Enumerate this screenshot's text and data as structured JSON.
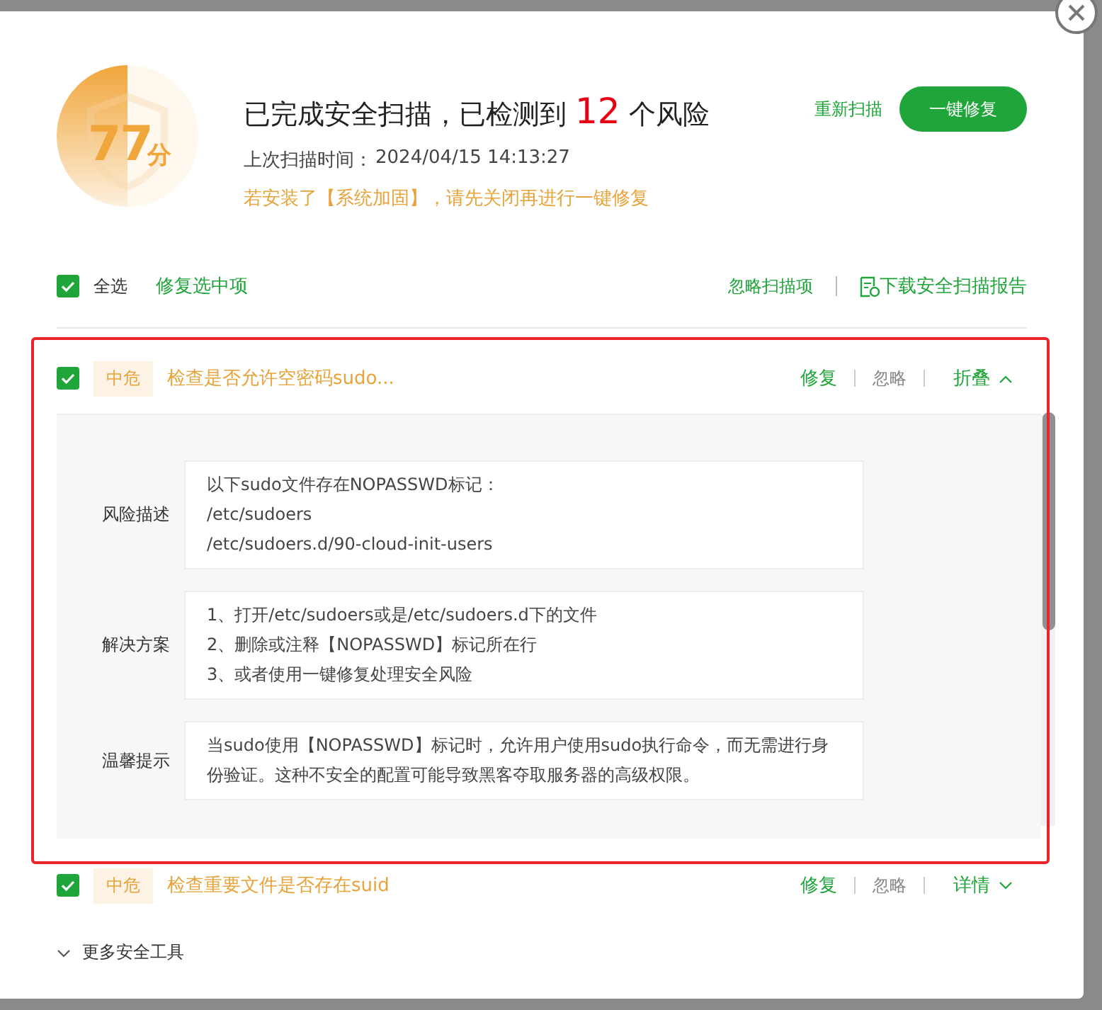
{
  "score": {
    "value": "77",
    "unit": "分"
  },
  "summary": {
    "prefix": "已完成安全扫描，已检测到",
    "count": "12",
    "suffix": "个风险"
  },
  "last_scan": {
    "label": "上次扫描时间：",
    "time": "2024/04/15 14:13:27"
  },
  "notice": "若安装了【系统加固】，请先关闭再进行一键修复",
  "actions": {
    "rescan": "重新扫描",
    "fix_all": "一键修复"
  },
  "toolbar": {
    "select_all": {
      "label": "全选",
      "checked": true
    },
    "fix_selected": "修复选中项",
    "ignore_items": "忽略扫描项",
    "download_report": "下载安全扫描报告"
  },
  "risks": [
    {
      "checked": true,
      "level": "中危",
      "title": "检查是否允许空密码sudo...",
      "fix": "修复",
      "ignore": "忽略",
      "toggle": "折叠",
      "expanded": true,
      "highlighted": true,
      "details": [
        {
          "label": "风险描述",
          "lines": [
            "以下sudo文件存在NOPASSWD标记：",
            "/etc/sudoers",
            "/etc/sudoers.d/90-cloud-init-users"
          ]
        },
        {
          "label": "解决方案",
          "lines": [
            "1、打开/etc/sudoers或是/etc/sudoers.d下的文件",
            "2、删除或注释【NOPASSWD】标记所在行",
            "3、或者使用一键修复处理安全风险"
          ]
        },
        {
          "label": "温馨提示",
          "lines": [
            "当sudo使用【NOPASSWD】标记时，允许用户使用sudo执行命令，而无需进行身份验证。这种不安全的配置可能导致黑客夺取服务器的高级权限。"
          ]
        }
      ]
    },
    {
      "checked": true,
      "level": "中危",
      "title": "检查重要文件是否存在suid",
      "fix": "修复",
      "ignore": "忽略",
      "toggle": "详情",
      "expanded": false,
      "highlighted": false
    }
  ],
  "more_tools": "更多安全工具"
}
